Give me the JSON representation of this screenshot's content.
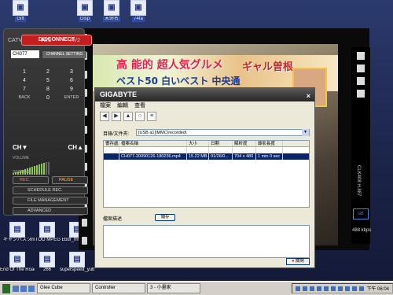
{
  "desktop_icons_top": [
    {
      "label": "Gift",
      "glyph": "▣"
    },
    {
      "label": "Disp",
      "glyph": "▣"
    },
    {
      "label": "末命名",
      "glyph": "▣"
    },
    {
      "label": "74fa",
      "glyph": "▣"
    }
  ],
  "desktop_icons_bottom": [
    {
      "label": "キャンバスク",
      "glyph": "▤"
    },
    {
      "label": "ImTOO MPEG Encoder Wiz",
      "glyph": "▤"
    },
    {
      "label": "bdr_fm_125",
      "glyph": "▤"
    },
    {
      "label": "End Of The Road",
      "glyph": "▤"
    },
    {
      "label": "266",
      "glyph": "▤"
    },
    {
      "label": "superspeed_yub Downloads/FS YBR.HCD.FG",
      "glyph": "▤"
    }
  ],
  "remote": {
    "disconnect": "DISCONNECT",
    "sources": [
      "CATV",
      "AV1",
      "AV2"
    ],
    "channel": "CH077",
    "channel_setting": "CHANNEL SETTING",
    "keys": [
      "1",
      "2",
      "3",
      "4",
      "5",
      "6",
      "7",
      "8",
      "9",
      "BACK",
      "0",
      "ENTER"
    ],
    "ch_down": "CH▼",
    "ch_up": "CH▲",
    "volume": "VOLUME",
    "setting": "SETTING",
    "rec": "REC.",
    "pause": "PAUSE",
    "schedule": "SCHEDULE REC.",
    "file_management": "FILE MANAGEMENT",
    "advanced": "ADVANCED"
  },
  "video": {
    "t1": "高 能的 超人気グルメ",
    "t2": "ギャル曽根",
    "t3": "ベスト50 白いベスト 中央通",
    "side_text": "CLK408 H.887",
    "kbps": "488 kbps"
  },
  "window": {
    "title": "GIGABYTE",
    "close_x": "×",
    "menu": [
      "檔案",
      "編輯",
      "查看"
    ],
    "dir_label": "目錄/文件夾:",
    "dir_value": "[USB a1]\\MMC\\recorded\\",
    "columns": [
      "響存處",
      "檔案名稱",
      "大小",
      "日期",
      "解析度",
      "錄影長度"
    ],
    "rows": [
      {
        "c0": "",
        "c1": "..",
        "c2": "",
        "c3": "",
        "c4": "",
        "c5": "",
        "selected": false
      },
      {
        "c0": "",
        "c1": "CH077-20090126-180236.mp4",
        "c2": "15.22 MB",
        "c3": "01/26/0...",
        "c4": "704 x 480",
        "c5": "1 min 0 sec",
        "selected": true
      }
    ],
    "desc_label": "檔案描述",
    "save": "儲存",
    "close_btn": "關閉"
  },
  "taskbar": {
    "tasks": [
      "Glee Cube",
      "Controller",
      "3 - 小畫家"
    ],
    "clock": "下午 06:04"
  },
  "colors": {
    "accent_red": "#c41e1e",
    "selection": "#0a246a",
    "titlebar": "#262626"
  }
}
